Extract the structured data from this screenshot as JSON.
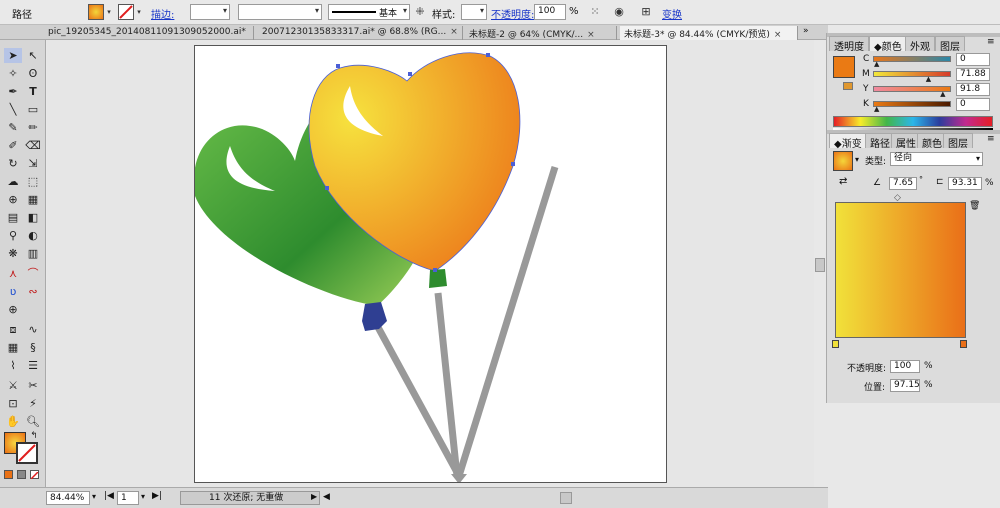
{
  "control_bar": {
    "label": "路径",
    "stroke_link": "描边:",
    "preset": "基本",
    "style_label": "样式:",
    "opacity_link": "不透明度:",
    "opacity_value": "100",
    "opacity_unit": "%",
    "transform_link": "变换"
  },
  "tabs": [
    {
      "label": "pic_19205345_20140811091309052000.ai*",
      "active": false
    },
    {
      "label": "20071230135833317.ai* @ 68.8% (RG...",
      "active": false
    },
    {
      "label": "未标题-2 @ 64% (CMYK/...",
      "active": false
    },
    {
      "label": "未标题-3* @ 84.44% (CMYK/预览)",
      "active": true
    }
  ],
  "color_panel": {
    "tabs": [
      "透明度",
      "颜色",
      "外观",
      "图层"
    ],
    "active_tab": "颜色",
    "channels": [
      {
        "name": "C",
        "value": "0",
        "marker": 0.0
      },
      {
        "name": "M",
        "value": "71.88",
        "marker": 0.7188
      },
      {
        "name": "Y",
        "value": "91.8",
        "marker": 0.918
      },
      {
        "name": "K",
        "value": "0",
        "marker": 0.0
      }
    ],
    "fill_color": "#ea7a14"
  },
  "gradient_panel": {
    "tabs": [
      "渐变",
      "路径",
      "属性",
      "颜色",
      "图层"
    ],
    "active_tab": "渐变",
    "type_label": "类型:",
    "type_value": "径向",
    "angle": "7.65",
    "aspect": "93.31",
    "aspect_unit": "%",
    "opacity_label": "不透明度:",
    "opacity_value": "100",
    "opacity_unit": "%",
    "location_label": "位置:",
    "location_value": "97.15",
    "location_unit": "%",
    "stops": [
      "#f1e13a",
      "#ea6f18"
    ]
  },
  "status_bar": {
    "zoom": "84.44%",
    "page": "1",
    "history": "11 次还原; 无重做"
  },
  "colors": {
    "green_light": "#6cc04a",
    "green_dark": "#2e8c2e",
    "orange_light": "#f6e23e",
    "orange_dark": "#ec7418",
    "string": "#999999",
    "knot_blue": "#2f3f92",
    "knot_green": "#2e8c2e",
    "selection": "#4b5fd6"
  }
}
